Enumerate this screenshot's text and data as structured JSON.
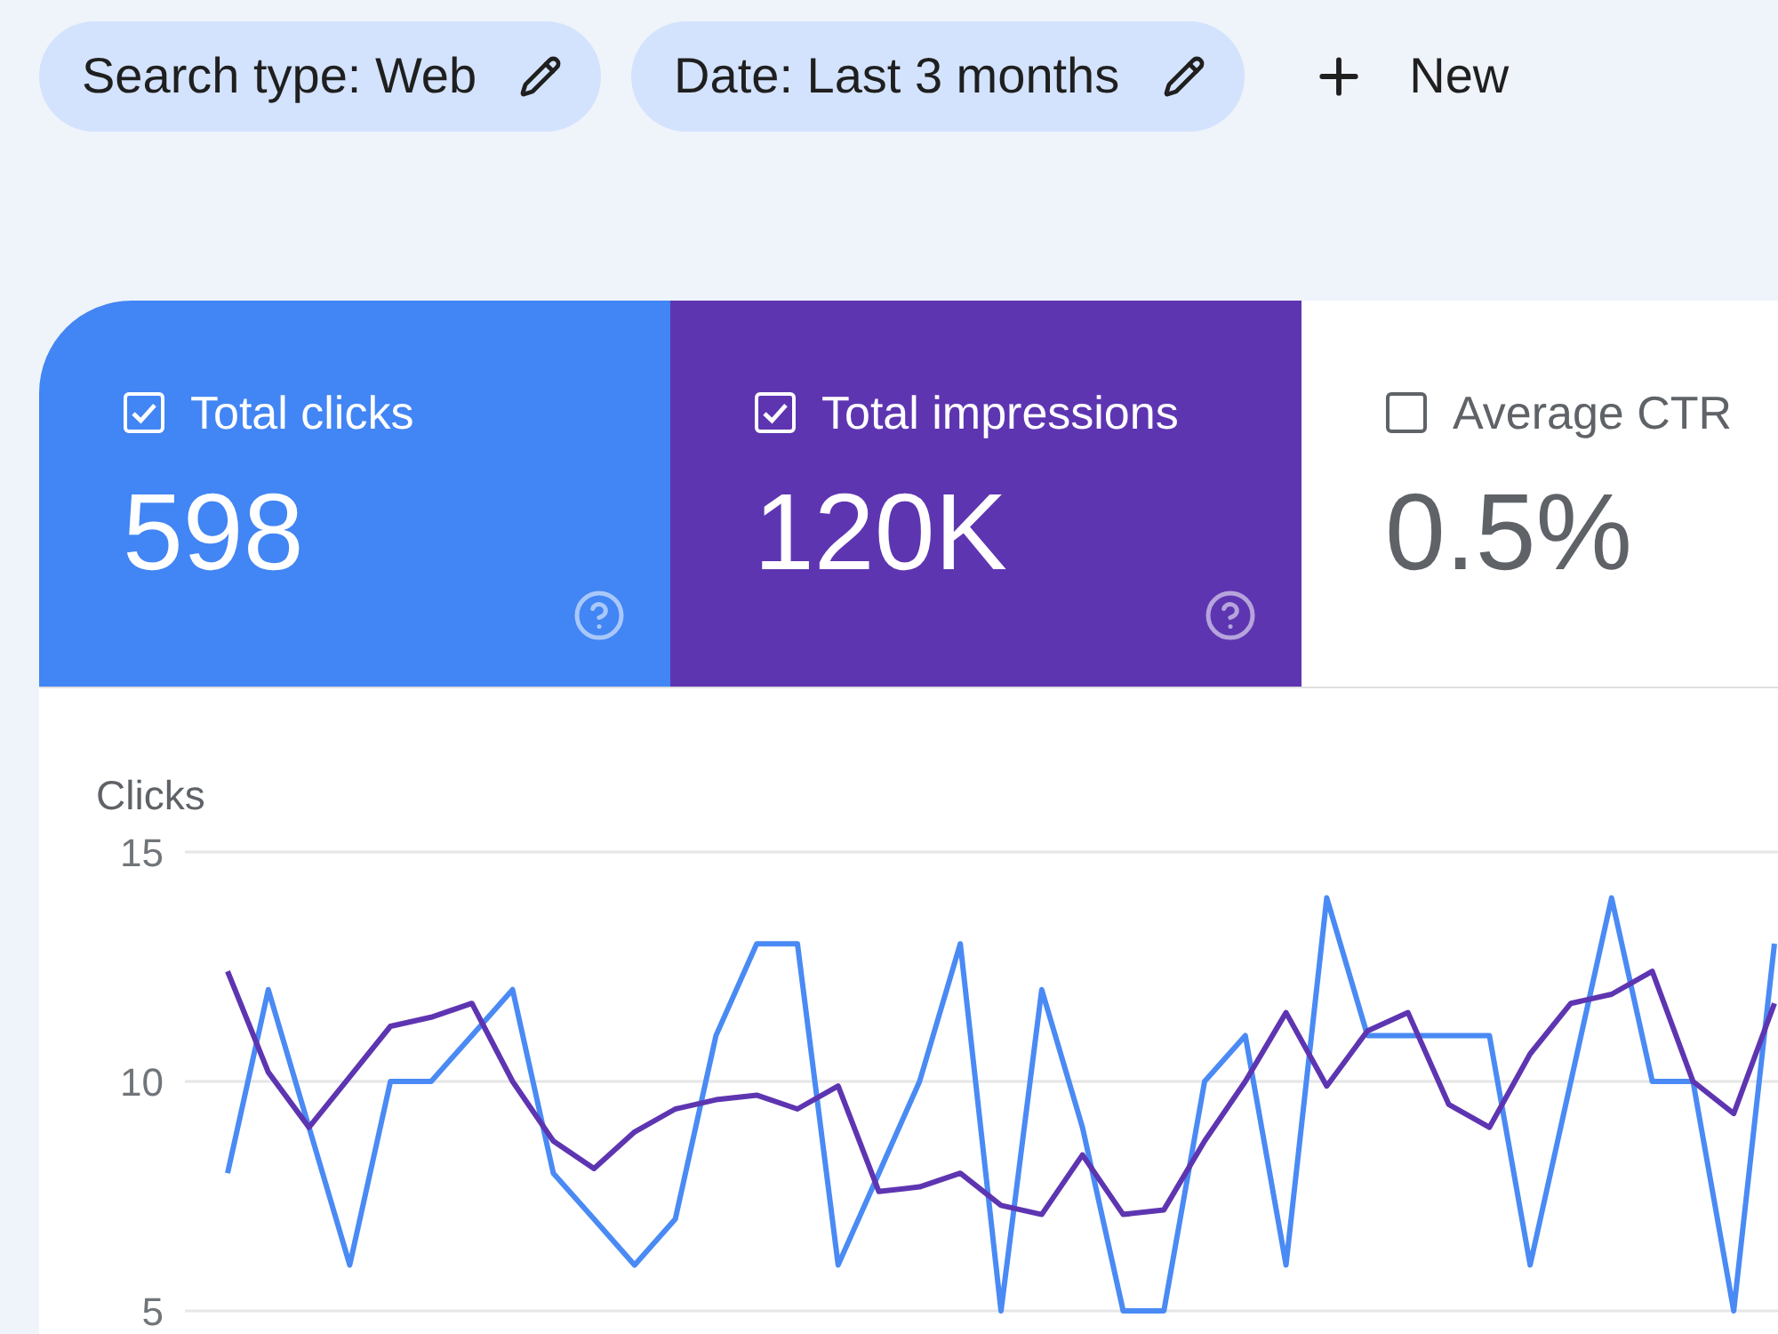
{
  "filters": [
    {
      "label": "Search type: Web"
    },
    {
      "label": "Date: Last 3 months"
    }
  ],
  "new_button": {
    "label": "New"
  },
  "metrics": [
    {
      "label": "Total clicks",
      "value": "598",
      "checked": true,
      "color": "#4285f4",
      "help": true
    },
    {
      "label": "Total impressions",
      "value": "120K",
      "checked": true,
      "color": "#5e35b1",
      "help": true
    },
    {
      "label": "Average CTR",
      "value": "0.5%",
      "checked": false,
      "help": false
    }
  ],
  "chart": {
    "chart_data": [
      {
        "type": "line",
        "ylabel": "Clicks",
        "ylim": [
          5,
          15
        ],
        "yticks": [
          5,
          10,
          15
        ],
        "grid": true,
        "categories": [
          null,
          null,
          null,
          null,
          null,
          null,
          null,
          null,
          null,
          null,
          null,
          null,
          null,
          null,
          null,
          null,
          null,
          null,
          null,
          null,
          null,
          null,
          null,
          null,
          null,
          null,
          null,
          null,
          null,
          null,
          null,
          null,
          null,
          null,
          null,
          null,
          null,
          null,
          null
        ],
        "series": [
          {
            "color": "#4a8af4",
            "values": [
              8,
              12,
              9,
              6,
              10,
              10,
              11,
              12,
              8,
              7,
              6,
              7,
              11,
              13,
              13,
              6,
              8,
              10,
              13,
              5,
              12,
              9,
              5,
              5,
              10,
              11,
              6,
              14,
              11,
              11,
              11,
              11,
              6,
              10,
              14,
              10,
              10,
              5,
              13
            ]
          },
          {
            "color": "#5e35b1",
            "values": [
              12.4,
              10.2,
              9.0,
              10.1,
              11.2,
              11.4,
              11.7,
              10.0,
              8.7,
              8.1,
              8.9,
              9.4,
              9.6,
              9.7,
              9.4,
              9.9,
              7.6,
              7.7,
              8.0,
              7.3,
              7.1,
              8.4,
              7.1,
              7.2,
              8.7,
              10.0,
              11.5,
              9.9,
              11.1,
              11.5,
              9.5,
              9.0,
              10.6,
              11.7,
              11.9,
              12.4,
              10.0,
              9.3,
              11.7
            ]
          }
        ]
      }
    ]
  }
}
